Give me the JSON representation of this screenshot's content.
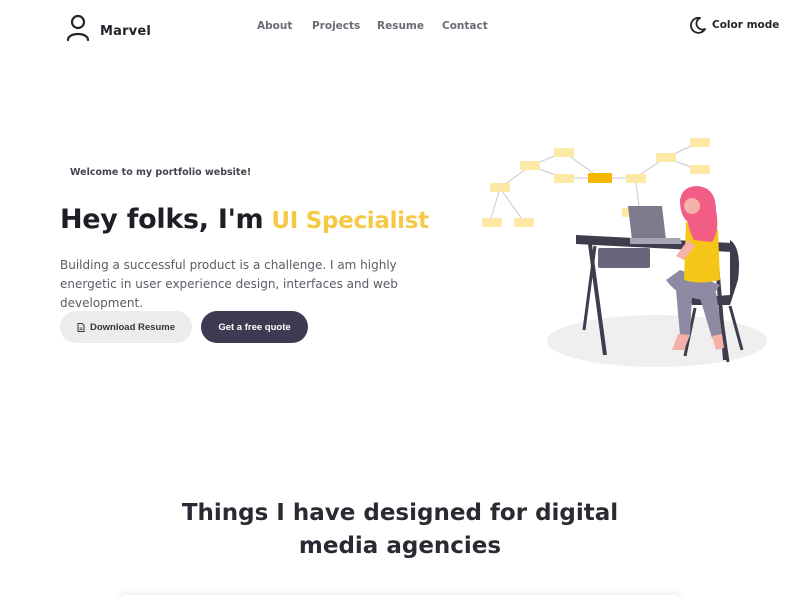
{
  "header": {
    "brand_name": "Marvel",
    "brand_icon": "user-icon",
    "nav": [
      "About",
      "Projects",
      "Resume",
      "Contact"
    ],
    "color_mode_label": "Color mode",
    "color_mode_icon": "moon-icon"
  },
  "hero": {
    "welcome": "Welcome to my portfolio website!",
    "title_prefix": "Hey folks, I'm",
    "title_accent": "UI Specialist",
    "description": "Building a successful product is a challenge. I am highly energetic in user experience design, interfaces and web development.",
    "download_label": "Download Resume",
    "download_icon": "document-icon",
    "quote_label": "Get a free quote"
  },
  "section": {
    "title_line1": "Things I have designed for digital",
    "title_line2": "media agencies"
  },
  "colors": {
    "accent": "#f6c944",
    "primary_button": "#3f3a52",
    "secondary_button": "#ececec",
    "heading": "#1e1e26"
  }
}
